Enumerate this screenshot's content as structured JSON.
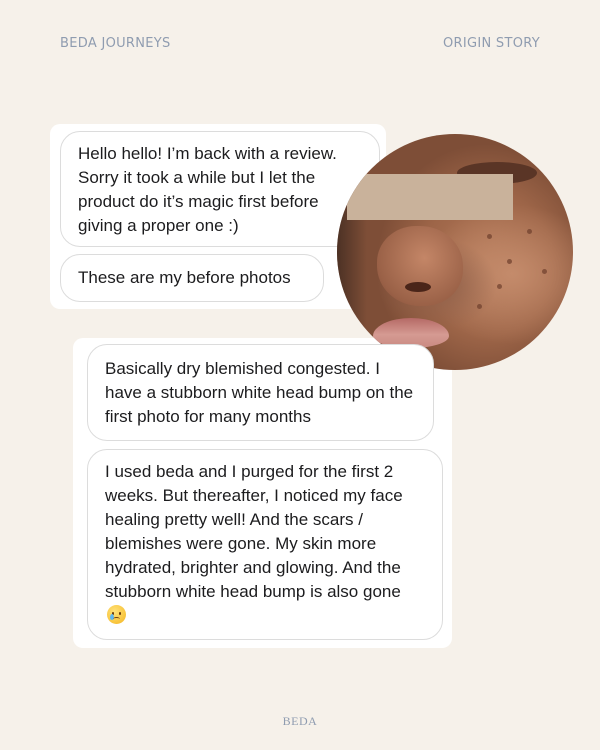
{
  "header": {
    "left_label": "BEDA JOURNEYS",
    "right_label": "ORIGIN STORY"
  },
  "messages": [
    {
      "text": "Hello hello! I’m back with a review. Sorry it took a while but I let the product do it’s magic first before giving a proper one :)"
    },
    {
      "text": "These are my before photos"
    },
    {
      "text": "Basically dry blemished congested. I have a stubborn white head bump on the first photo for many months"
    },
    {
      "text": "I used beda and I purged for the first 2 weeks. But thereafter, I noticed my face healing pretty well! And the scars / blemishes were gone. My skin more hydrated, brighter and glowing. And the stubborn white head bump is also gone",
      "emoji": "face-holding-back-tears"
    }
  ],
  "photo": {
    "icon": "before-face-photo"
  },
  "footer": {
    "brand": "BEDA"
  },
  "colors": {
    "background": "#f6f1ea",
    "label": "#8f9cb0",
    "bubble_border": "#dcdcdc",
    "text": "#1c1c1e"
  }
}
